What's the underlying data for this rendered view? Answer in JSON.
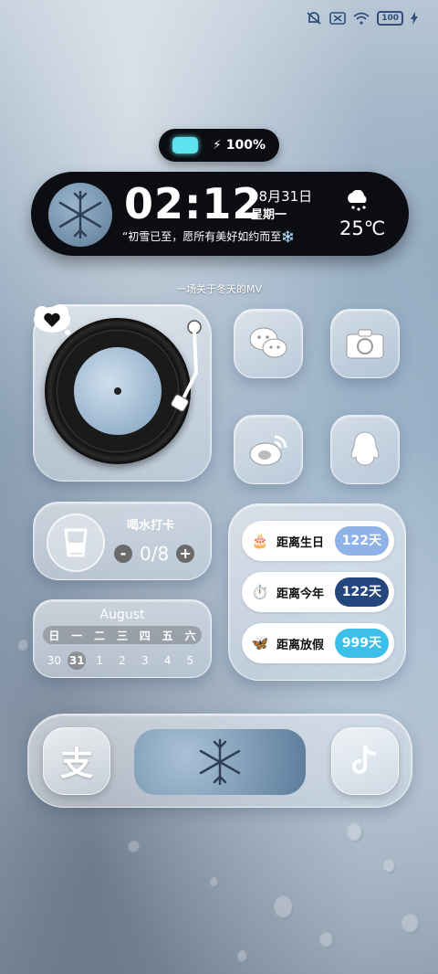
{
  "status_bar": {
    "battery_level": "100",
    "icons": [
      "bell-off-icon",
      "sim-off-icon",
      "wifi-icon",
      "battery-icon",
      "charging-icon"
    ]
  },
  "battery_pill": {
    "text": "100%"
  },
  "clock": {
    "time": "02:12",
    "date": "08月31日",
    "weekday": "星期一",
    "quote": "“初雪已至，愿所有美好如约而至❄️",
    "temperature": "25℃",
    "weather_icon": "snow-cloud-icon"
  },
  "mv_label": "一场关于冬天的MV",
  "apps": [
    {
      "name": "wechat",
      "icon": "wechat-icon"
    },
    {
      "name": "camera",
      "icon": "camera-icon"
    },
    {
      "name": "weibo",
      "icon": "weibo-icon"
    },
    {
      "name": "qq",
      "icon": "qq-penguin-icon"
    }
  ],
  "water": {
    "title": "喝水打卡",
    "minus": "-",
    "plus": "+",
    "count": "0/8"
  },
  "calendar": {
    "month": "August",
    "weekdays": [
      "日",
      "一",
      "二",
      "三",
      "四",
      "五",
      "六"
    ],
    "dates": [
      "30",
      "31",
      "1",
      "2",
      "3",
      "4",
      "5"
    ],
    "today_index": 1
  },
  "countdowns": [
    {
      "emoji": "🎂",
      "label": "距离生日",
      "value": "122天",
      "color": "#8fb3e6"
    },
    {
      "emoji": "⏱️",
      "label": "距离今年",
      "value": "122天",
      "color": "#24467c"
    },
    {
      "emoji": "🦋",
      "label": "距离放假",
      "value": "999天",
      "color": "#3cc0ea"
    }
  ],
  "dock": {
    "apps": [
      {
        "name": "alipay",
        "icon": "alipay-icon",
        "glyph": "支"
      },
      {
        "name": "tiktok",
        "icon": "tiktok-icon"
      }
    ]
  },
  "colors": {
    "accent_cyan": "#5ee3ee",
    "dark_pill": "#0b0d12"
  }
}
